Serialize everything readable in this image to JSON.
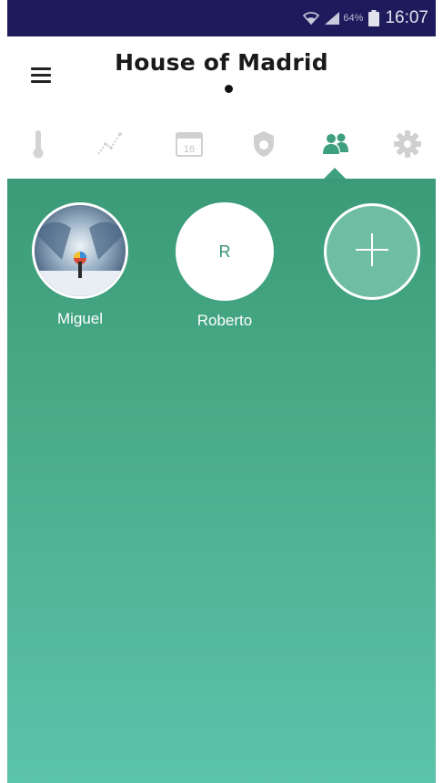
{
  "status_bar": {
    "battery_percent": "64%",
    "time": "16:07",
    "icons": [
      "wifi-icon",
      "signal-icon",
      "battery-icon"
    ]
  },
  "header": {
    "title": "House of Madrid",
    "menu_icon": "hamburger-menu-icon"
  },
  "tabs": [
    {
      "id": "temperature",
      "icon": "thermometer-icon"
    },
    {
      "id": "graph",
      "icon": "line-chart-icon"
    },
    {
      "id": "calendar",
      "icon": "calendar-icon",
      "text": "16"
    },
    {
      "id": "away",
      "icon": "shield-icon"
    },
    {
      "id": "users",
      "icon": "users-icon",
      "active": true
    },
    {
      "id": "settings",
      "icon": "gear-icon"
    }
  ],
  "members": [
    {
      "name": "Miguel",
      "avatar": "photo"
    },
    {
      "name": "Roberto",
      "avatar_initial": "R"
    }
  ],
  "add_member_icon": "plus-icon",
  "colors": {
    "status_bar": "#1e1b5c",
    "accent": "#3fa07f",
    "gradient_top": "#3b9b78",
    "gradient_bottom": "#5cc3ac",
    "inactive_icon": "#c8c8c8"
  }
}
